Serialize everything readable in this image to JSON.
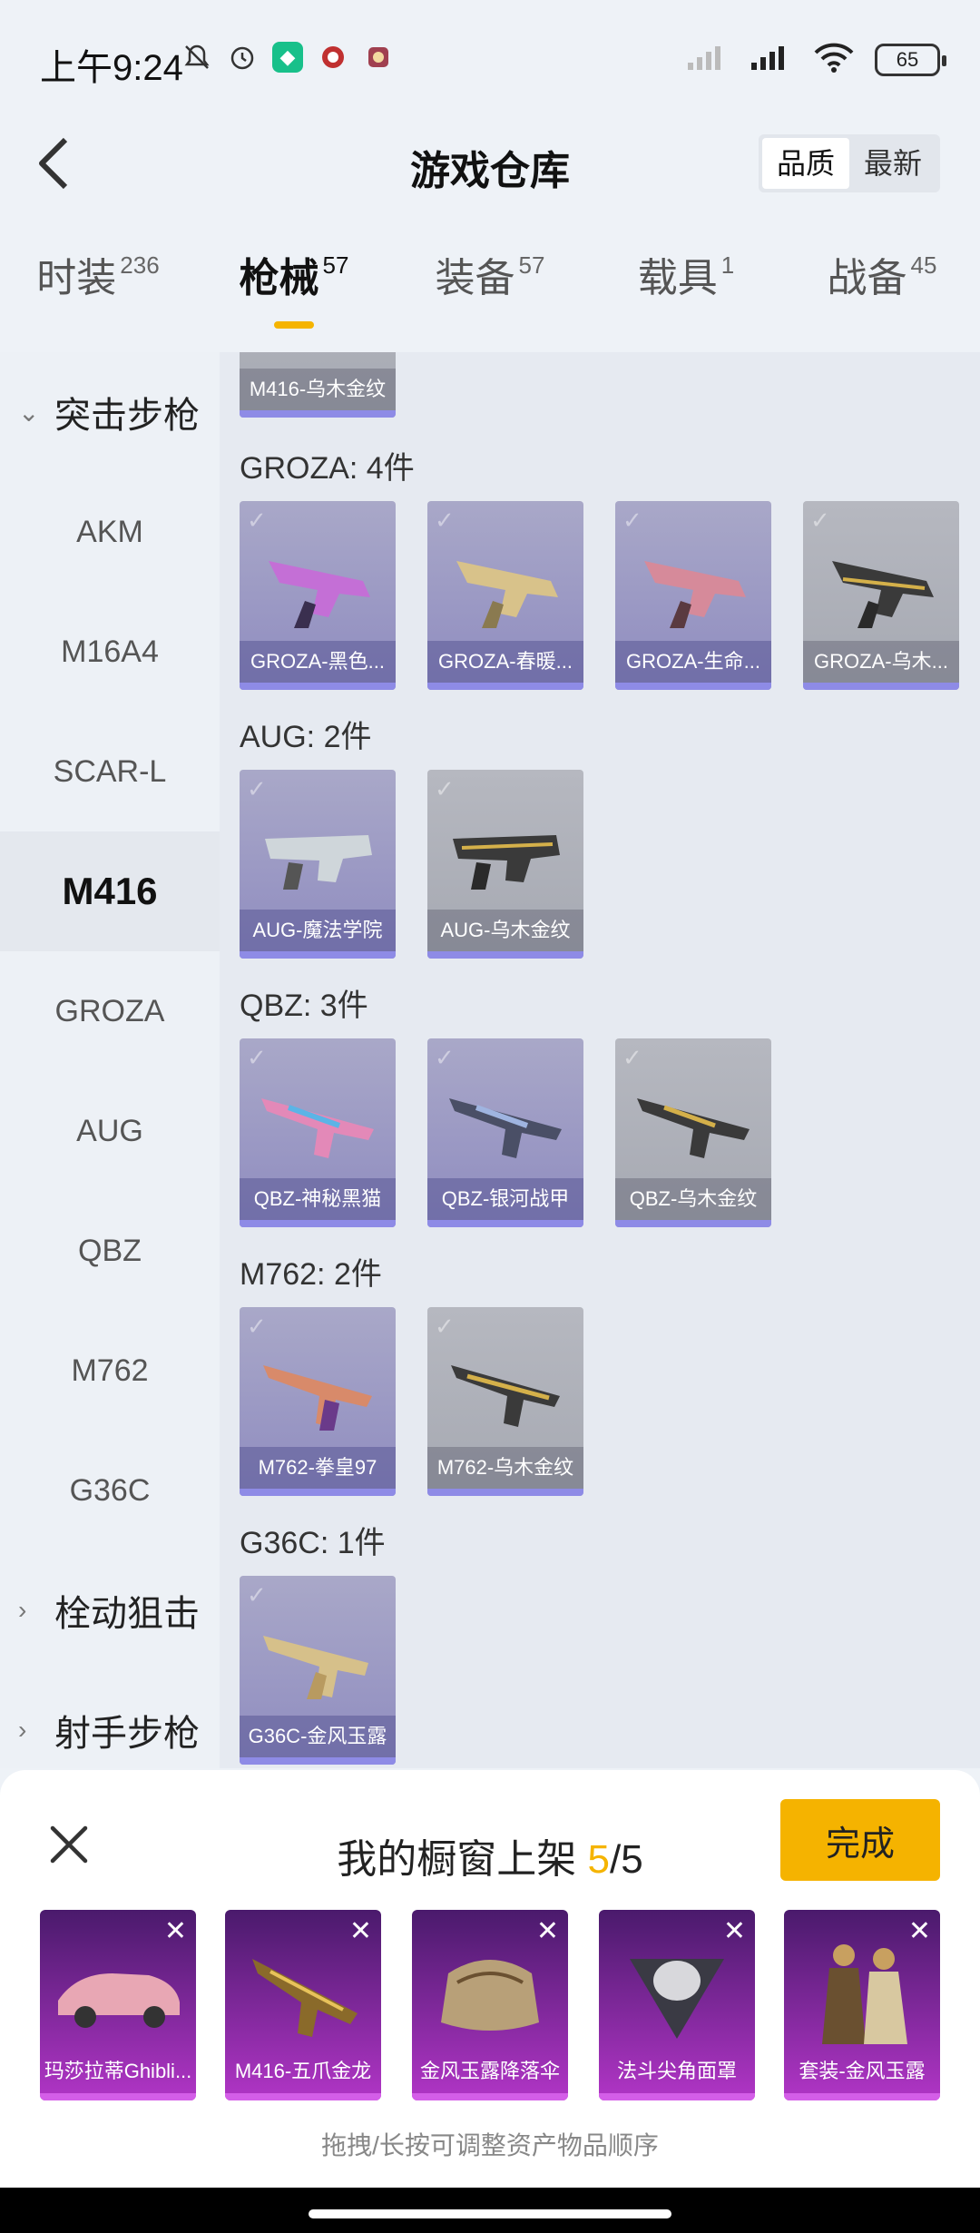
{
  "status_bar": {
    "time": "上午9:24",
    "battery": "65",
    "icons": [
      "mute-icon",
      "alarm-icon",
      "vpn-icon",
      "app-icon",
      "app-icon",
      "signal-icon",
      "signal-icon",
      "wifi-icon",
      "battery-icon"
    ]
  },
  "header": {
    "title": "游戏仓库"
  },
  "sort": {
    "quality": "品质",
    "newest": "最新",
    "selected": "品质"
  },
  "tabs": [
    {
      "label": "时装",
      "count": "236"
    },
    {
      "label": "枪械",
      "count": "57"
    },
    {
      "label": "装备",
      "count": "57"
    },
    {
      "label": "载具",
      "count": "1"
    },
    {
      "label": "战备",
      "count": "45"
    }
  ],
  "sidebar": {
    "group_expanded": "突击步枪",
    "items": [
      "AKM",
      "M16A4",
      "SCAR-L",
      "M416",
      "GROZA",
      "AUG",
      "QBZ",
      "M762",
      "G36C"
    ],
    "active": "M416",
    "group_sniper": "栓动狙击",
    "group_marksman": "射手步枪"
  },
  "main": {
    "top_partial_card": "M416-乌木金纹",
    "sections": [
      {
        "title": "GROZA: 4件",
        "items": [
          "GROZA-黑色...",
          "GROZA-春暖...",
          "GROZA-生命...",
          "GROZA-乌木..."
        ]
      },
      {
        "title": "AUG: 2件",
        "items": [
          "AUG-魔法学院",
          "AUG-乌木金纹"
        ]
      },
      {
        "title": "QBZ: 3件",
        "items": [
          "QBZ-神秘黑猫",
          "QBZ-银河战甲",
          "QBZ-乌木金纹"
        ]
      },
      {
        "title": "M762: 2件",
        "items": [
          "M762-拳皇97",
          "M762-乌木金纹"
        ]
      },
      {
        "title": "G36C: 1件",
        "items": [
          "G36C-金风玉露"
        ]
      }
    ]
  },
  "showcase": {
    "title_prefix": "我的橱窗上架",
    "count_current": "5",
    "count_total": "/5",
    "done": "完成",
    "slots": [
      "玛莎拉蒂Ghibli...",
      "M416-五爪金龙",
      "金风玉露降落伞",
      "法斗尖角面罩",
      "套装-金风玉露"
    ],
    "hint": "拖拽/长按可调整资产物品顺序"
  },
  "colors": {
    "accent": "#f5b400",
    "purple_card": "#8f8cc0",
    "showcase_slot": "#b135c6"
  }
}
